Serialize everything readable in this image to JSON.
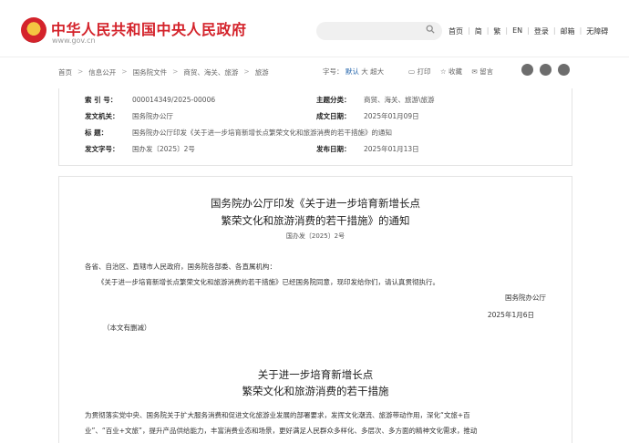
{
  "header": {
    "site_title": "中华人民共和国中央人民政府",
    "site_url": "www.gov.cn",
    "links": [
      "首页",
      "简",
      "繁",
      "EN",
      "登录",
      "邮箱",
      "无障碍"
    ]
  },
  "breadcrumb": [
    "首页",
    "信息公开",
    "国务院文件",
    "商贸、海关、旅游",
    "旅游"
  ],
  "font_size": {
    "label": "字号：",
    "default": "默认",
    "big": "大",
    "bigger": "超大"
  },
  "tools": {
    "print": "打印",
    "favorite": "收藏",
    "retain": "留言"
  },
  "share_icons": [
    "weibo-icon",
    "wechat-icon",
    "qzone-icon"
  ],
  "meta": {
    "index_no_label": "索 引 号：",
    "index_no": "000014349/2025-00006",
    "topic_label": "主题分类：",
    "topic": "商贸、海关、旅游\\旅游",
    "issuer_label": "发文机关：",
    "issuer": "国务院办公厅",
    "created_label": "成文日期：",
    "created": "2025年01月09日",
    "title_label": "标    题：",
    "title": "国务院办公厅印发《关于进一步培育新增长点繁荣文化和旅游消费的若干措施》的通知",
    "docno_label": "发文字号：",
    "docno": "国办发〔2025〕2号",
    "published_label": "发布日期：",
    "published": "2025年01月13日"
  },
  "doc": {
    "title_line1": "国务院办公厅印发《关于进一步培育新增长点",
    "title_line2": "繁荣文化和旅游消费的若干措施》的通知",
    "doc_no": "国办发〔2025〕2号",
    "salutation": "各省、自治区、直辖市人民政府，国务院各部委、各直属机构：",
    "body": "《关于进一步培育新增长点繁荣文化和旅游消费的若干措施》已经国务院同意，现印发给你们，请认真贯彻执行。",
    "signer": "国务院办公厅",
    "date": "2025年1月6日",
    "note": "（本文有删减）",
    "section_title1": "关于进一步培育新增长点",
    "section_title2": "繁荣文化和旅游消费的若干措施",
    "para1": "为贯彻落实党中央、国务院关于扩大服务消费和促进文化旅游业发展的部署要求，发挥文化潮流、旅游带动作用，深化“文旅+百",
    "para2": "业”、“百业+文旅”，提升产品供给能力，丰富消费业态和场景，更好满足人民群众多样化、多层次、多方面的精神文化需求，推动"
  }
}
